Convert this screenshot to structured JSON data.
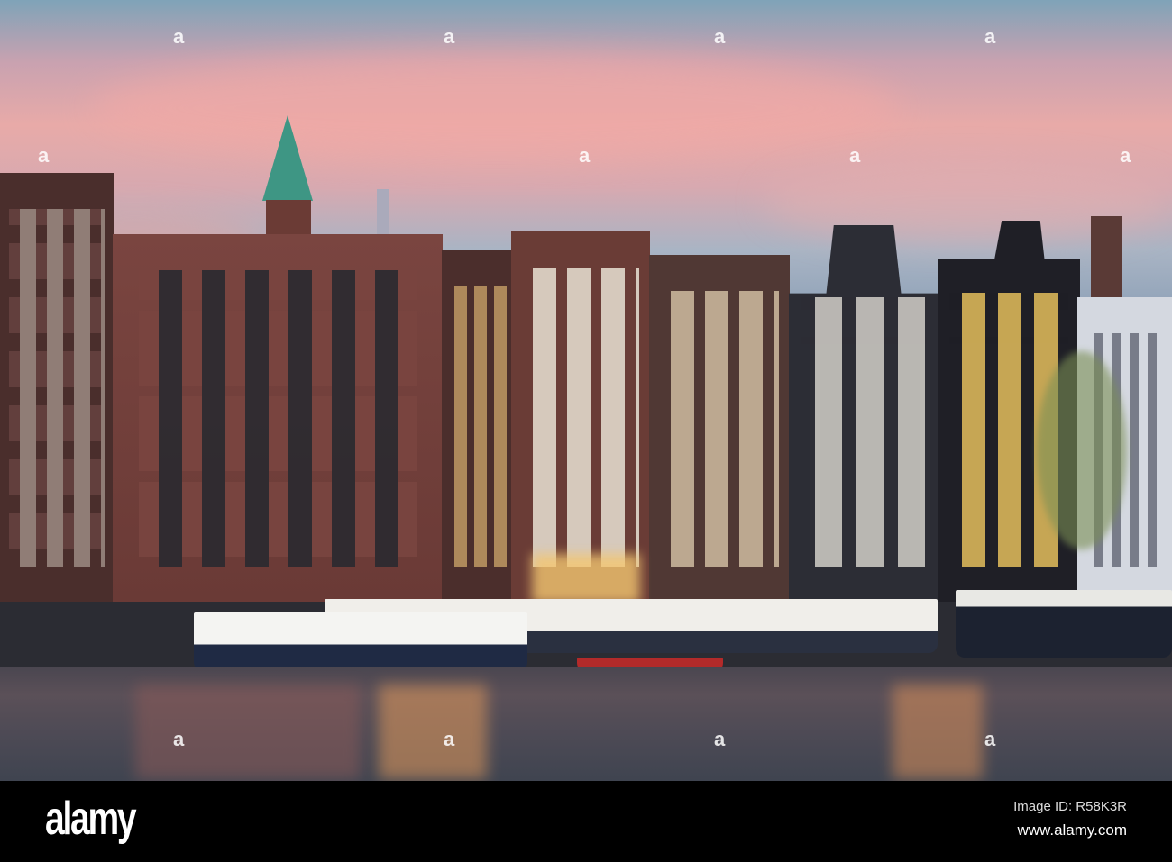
{
  "photo": {
    "subject": "Amsterdam canal houses at dusk"
  },
  "watermark": {
    "glyph": "a"
  },
  "footer": {
    "logo": "alamy",
    "image_id": "Image ID: R58K3R",
    "website": "www.alamy.com"
  }
}
